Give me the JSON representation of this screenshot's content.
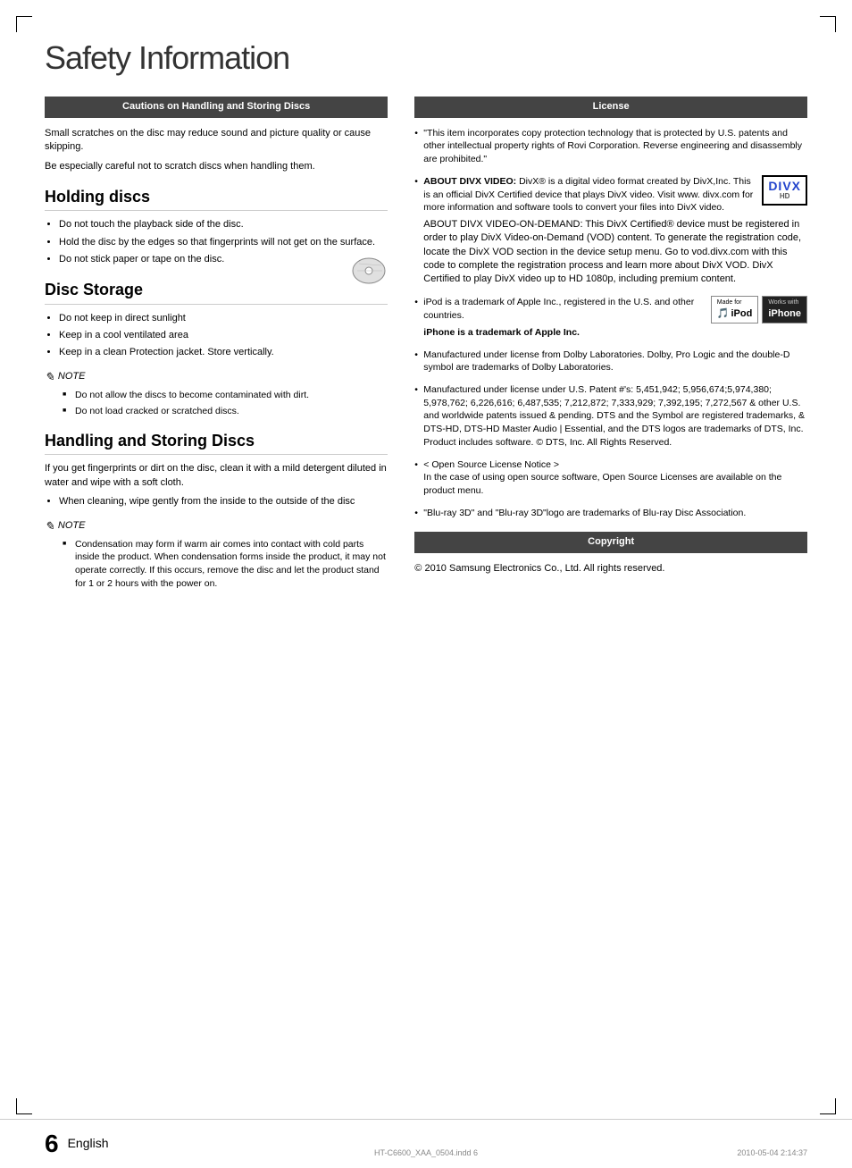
{
  "page": {
    "title": "Safety Information",
    "footer": {
      "page_number": "6",
      "language": "English",
      "filename": "HT-C6600_XAA_0504.indd   6",
      "date": "2010-05-04   2:14:37"
    }
  },
  "left": {
    "cautions_header": "Cautions on Handling and Storing Discs",
    "cautions_text1": "Small scratches on the disc may reduce sound and picture quality or cause skipping.",
    "cautions_text2": "Be especially careful not to scratch discs when handling them.",
    "holding_discs": {
      "title": "Holding discs",
      "items": [
        "Do not touch the playback side of the disc.",
        "Hold the disc by the edges so that fingerprints will not get on the surface.",
        "Do not stick paper or tape on the disc."
      ]
    },
    "disc_storage": {
      "title": "Disc Storage",
      "items": [
        "Do not keep in direct sunlight",
        "Keep in a cool ventilated area",
        "Keep in a clean Protection jacket. Store vertically."
      ],
      "note": {
        "label": "NOTE",
        "items": [
          "Do not allow the discs to become contaminated with dirt.",
          "Do not load cracked or scratched discs."
        ]
      }
    },
    "handling": {
      "title": "Handling and Storing Discs",
      "text": "If you get fingerprints or dirt on the disc, clean it with a mild detergent diluted in water and wipe with a soft cloth.",
      "items": [
        "When cleaning, wipe gently from the inside to the outside of the disc"
      ],
      "note": {
        "label": "NOTE",
        "items": [
          "Condensation may form if warm air comes into contact with cold parts inside the product. When condensation forms inside the product, it may not operate correctly. If this occurs, remove the disc and let the product stand for 1 or 2 hours with the power on."
        ]
      }
    }
  },
  "right": {
    "license_header": "License",
    "bullet1": "\"This item incorporates copy protection technology that is protected by U.S. patents and other intellectual property rights of Rovi Corporation. Reverse engineering and disassembly are prohibited.\"",
    "bullet2_title": "ABOUT DIVX VIDEO:",
    "bullet2_text": "DivX® is a digital video format created by DivX,Inc. This is an official DivX Certified device that plays DivX video. Visit www. divx.com for more information and software tools to convert your files into DivX video.",
    "bullet2_vod": "ABOUT DIVX VIDEO-ON-DEMAND: This DivX Certified® device must be registered in order to play DivX Video-on-Demand (VOD) content. To generate the registration code, locate the DivX VOD section in the device setup menu. Go to vod.divx.com with this code to complete the registration process and learn more about DivX VOD. DivX Certified to play DivX video up to HD 1080p, including premium content.",
    "divx_logo_line1": "DIV",
    "divx_logo_line2": "X",
    "divx_logo_hd": "HD",
    "bullet3_text1": "iPod is a trademark of Apple Inc., registered in the U.S. and other countries.",
    "bullet3_text2": "iPhone is a trademark of Apple Inc.",
    "ipod_badge": {
      "made_for": "Made for",
      "brand": "iPod"
    },
    "iphone_badge": {
      "works_with": "Works with",
      "brand": "iPhone"
    },
    "bullet4": "Manufactured under license from Dolby Laboratories. Dolby, Pro Logic and the double-D symbol are trademarks of Dolby Laboratories.",
    "bullet5": "Manufactured under license under U.S. Patent #'s: 5,451,942; 5,956,674;5,974,380; 5,978,762; 6,226,616; 6,487,535; 7,212,872; 7,333,929; 7,392,195; 7,272,567 & other U.S. and worldwide patents issued & pending. DTS and the Symbol are registered trademarks, & DTS-HD, DTS-HD Master Audio | Essential, and the DTS logos are trademarks of DTS, Inc. Product includes software. © DTS, Inc. All Rights Reserved.",
    "bullet6_title": "< Open Source License Notice >",
    "bullet6_text": "In the case of using open source software, Open Source Licenses are available on the product menu.",
    "bullet7": "\"Blu-ray 3D\" and \"Blu-ray 3D\"logo are trademarks of Blu-ray Disc Association.",
    "copyright_header": "Copyright",
    "copyright_text": "© 2010 Samsung Electronics Co., Ltd. All rights reserved."
  }
}
